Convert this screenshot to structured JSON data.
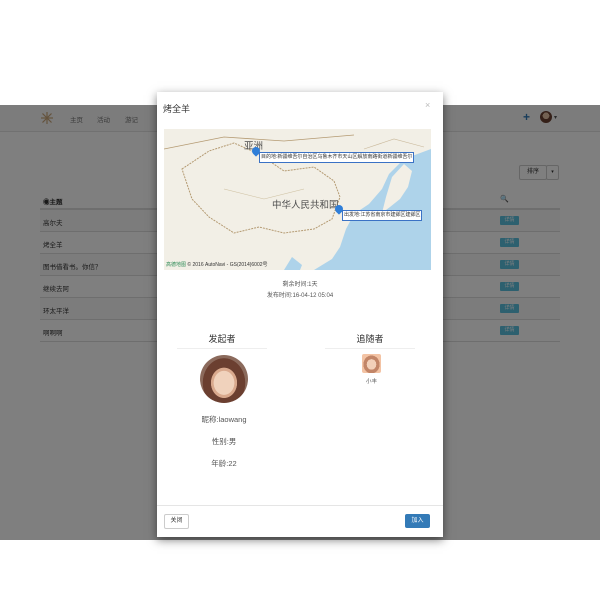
{
  "nav": {
    "links": [
      "主页",
      "活动",
      "游记"
    ],
    "plus": "+",
    "caret": "▾"
  },
  "toolbar": {
    "sort_label": "排序",
    "sort_caret": "▾"
  },
  "table": {
    "header_title": "主题",
    "header_icon": "🔍",
    "rows": [
      {
        "name": "高尔夫",
        "action": "详情"
      },
      {
        "name": "烤全羊",
        "action": "详情"
      },
      {
        "name": "图书借看书。你信？",
        "action": "详情"
      },
      {
        "name": "继续去阿",
        "action": "详情"
      },
      {
        "name": "环太平洋",
        "action": "详情"
      },
      {
        "name": "啊啊啊",
        "action": "详情"
      }
    ]
  },
  "modal": {
    "title": "烤全羊",
    "close_x": "×",
    "map": {
      "label_region": "亚洲",
      "label_country": "中华人民共和国",
      "destination": "目的地:新疆维吾尔自治区乌鲁木齐市天山区解放南路街道新疆维吾尔",
      "origin": "出发地:江苏省南京市建邺区建邺区",
      "copyright_brand": "高德地图",
      "copyright": "© 2016 AutoNavi - GS(2014)6002号"
    },
    "remaining": "剩余时间:1天",
    "published": "发布时间:16-04-12 05:04",
    "initiator": {
      "heading": "发起者",
      "nickname": "昵称:laowang",
      "gender": "性别:男",
      "age": "年龄:22"
    },
    "followers": {
      "heading": "追随者",
      "items": [
        {
          "name": "小丰"
        }
      ]
    },
    "close_button": "关闭",
    "join_button": "加入"
  }
}
